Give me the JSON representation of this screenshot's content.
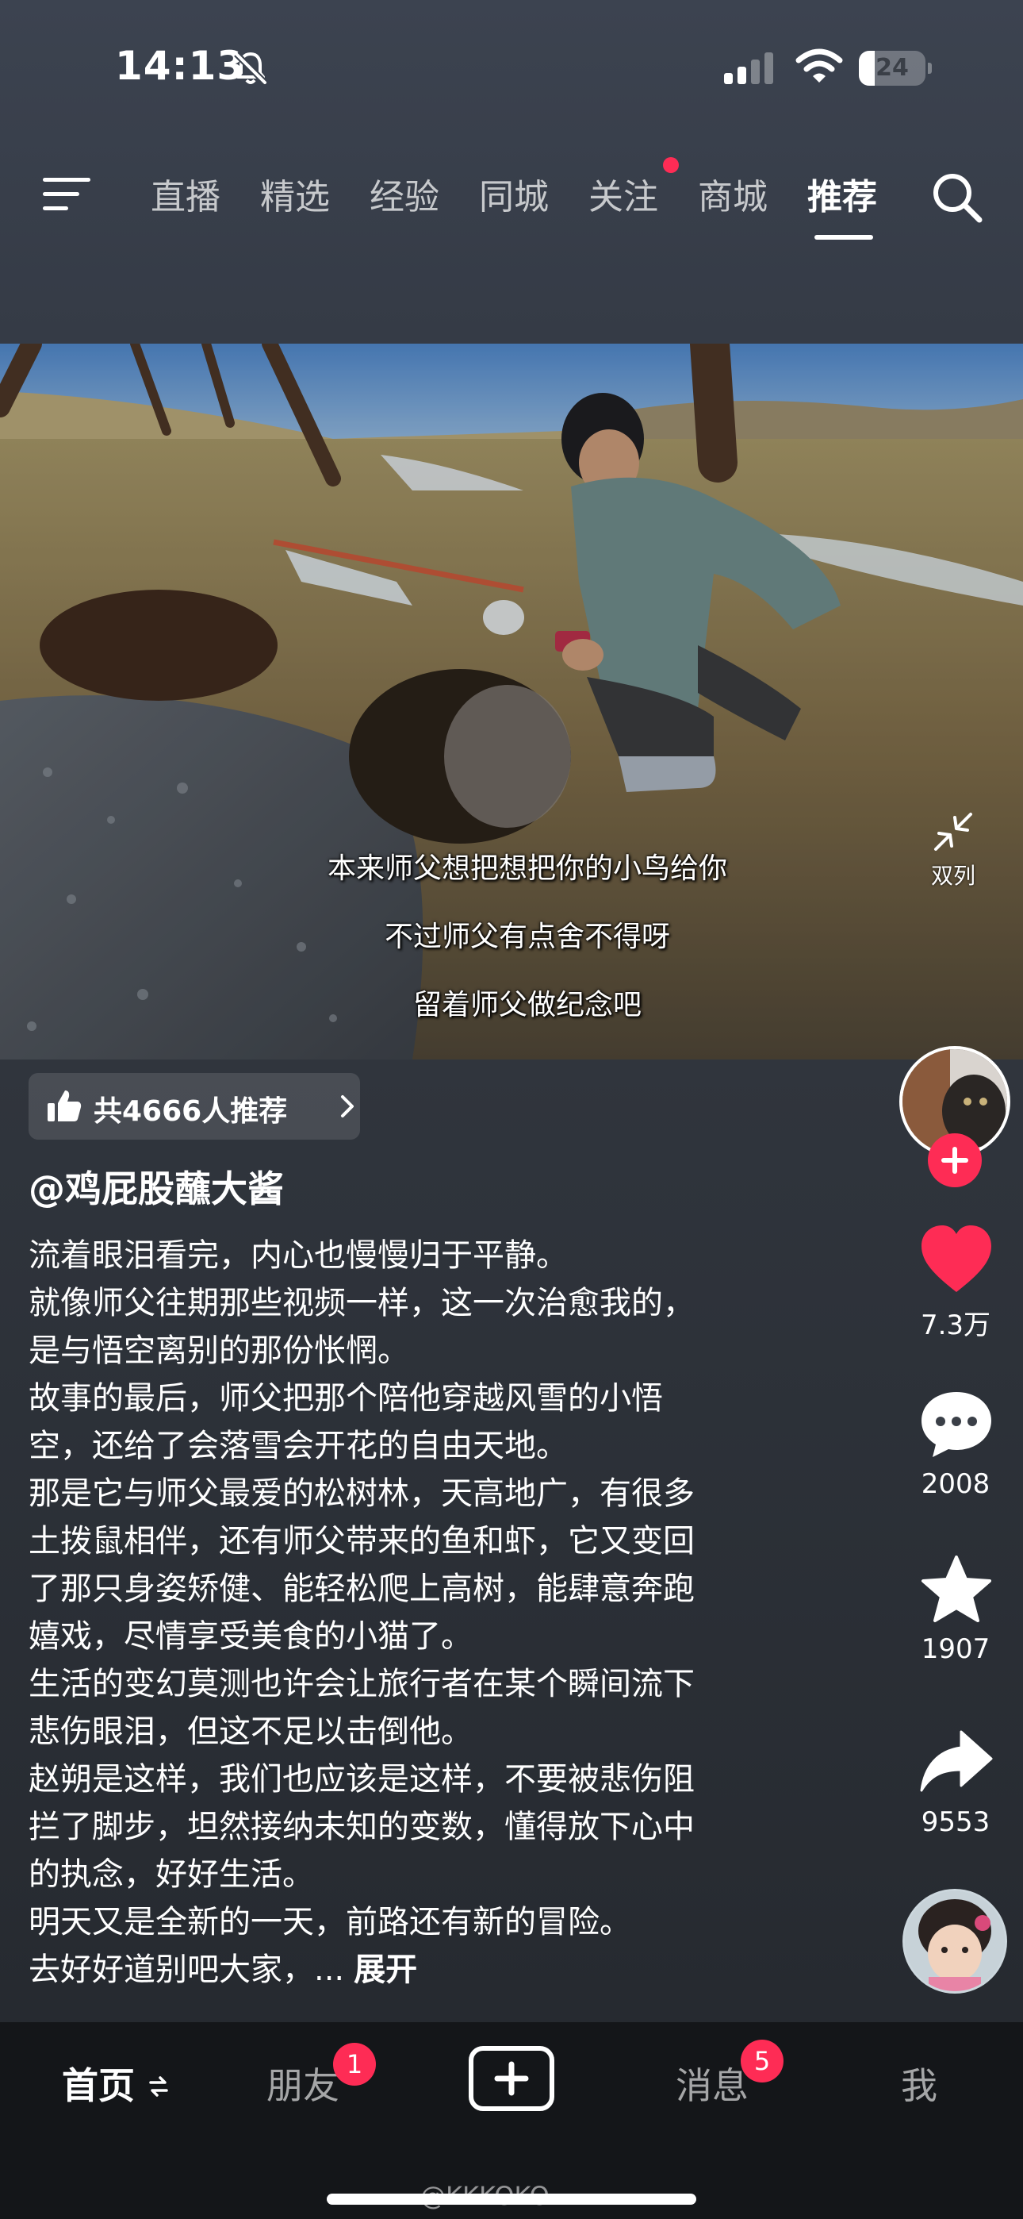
{
  "status_bar": {
    "time": "14:13",
    "battery_level": "24",
    "battery_fraction": 0.24
  },
  "top_nav": {
    "tabs": [
      {
        "label": "直播"
      },
      {
        "label": "精选"
      },
      {
        "label": "经验"
      },
      {
        "label": "同城"
      },
      {
        "label": "关注",
        "has_dot": true
      },
      {
        "label": "商城"
      },
      {
        "label": "推荐",
        "active": true
      }
    ]
  },
  "video": {
    "subtitles": [
      "本来师父想把想把你的小鸟给你",
      "不过师父有点舍不得呀",
      "留着师父做纪念吧"
    ],
    "dual_column_label": "双列"
  },
  "recommend": {
    "label": "共4666人推荐"
  },
  "author": "@鸡屁股蘸大酱",
  "description": {
    "lines": [
      "流着眼泪看完，内心也慢慢归于平静。",
      "就像师父往期那些视频一样，这一次治愈我的，",
      "是与悟空离别的那份怅惘。",
      "故事的最后，师父把那个陪他穿越风雪的小悟",
      "空，还给了会落雪会开花的自由天地。",
      "那是它与师父最爱的松树林，天高地广，有很多",
      "土拨鼠相伴，还有师父带来的鱼和虾，它又变回",
      "了那只身姿矫健、能轻松爬上高树，能肆意奔跑",
      "嬉戏，尽情享受美食的小猫了。",
      "生活的变幻莫测也许会让旅行者在某个瞬间流下",
      "悲伤眼泪，但这不足以击倒他。",
      "赵朔是这样，我们也应该是这样，不要被悲伤阻",
      "拦了脚步，坦然接纳未知的变数，懂得放下心中",
      "的执念，好好生活。",
      "明天又是全新的一天，前路还有新的冒险。"
    ],
    "last_line": "去好好道别吧大家，...",
    "expand": "展开"
  },
  "actions": {
    "likes": "7.3万",
    "comments": "2008",
    "favorites": "1907",
    "shares": "9553"
  },
  "bottom_nav": {
    "home": "首页",
    "friends": "朋友",
    "friends_badge": "1",
    "messages": "消息",
    "messages_badge": "5",
    "me": "我"
  },
  "watermark": "@KKKOKO",
  "colors": {
    "accent": "#fe2c55",
    "background": "#30353d",
    "nav_bar": "#141619"
  }
}
